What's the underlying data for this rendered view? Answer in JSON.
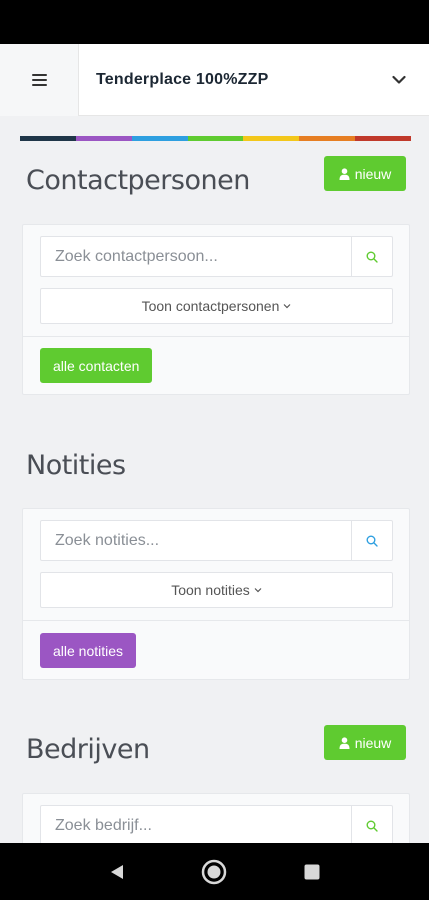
{
  "header": {
    "title": "Tenderplace 100%ZZP",
    "menu_icon": "hamburger-icon",
    "dropdown_icon": "chevron-down-icon"
  },
  "colorbar": [
    "#1f3648",
    "#9b56c3",
    "#2e9fe0",
    "#5fcb30",
    "#f3c71a",
    "#e67e22",
    "#c0392b"
  ],
  "contacts": {
    "title": "Contactpersonen",
    "new_label": "nieuw",
    "search_placeholder": "Zoek contactpersoon...",
    "toggle_label": "Toon contactpersonen",
    "all_label": "alle contacten",
    "button_color": "#5fcb30"
  },
  "notes": {
    "title": "Notities",
    "search_placeholder": "Zoek notities...",
    "toggle_label": "Toon notities",
    "all_label": "alle notities",
    "button_color": "#9b56c3"
  },
  "companies": {
    "title": "Bedrijven",
    "new_label": "nieuw",
    "search_placeholder": "Zoek bedrijf..."
  },
  "navbar": {
    "back_icon": "back-icon",
    "home_icon": "home-icon",
    "recents_icon": "recents-icon"
  }
}
